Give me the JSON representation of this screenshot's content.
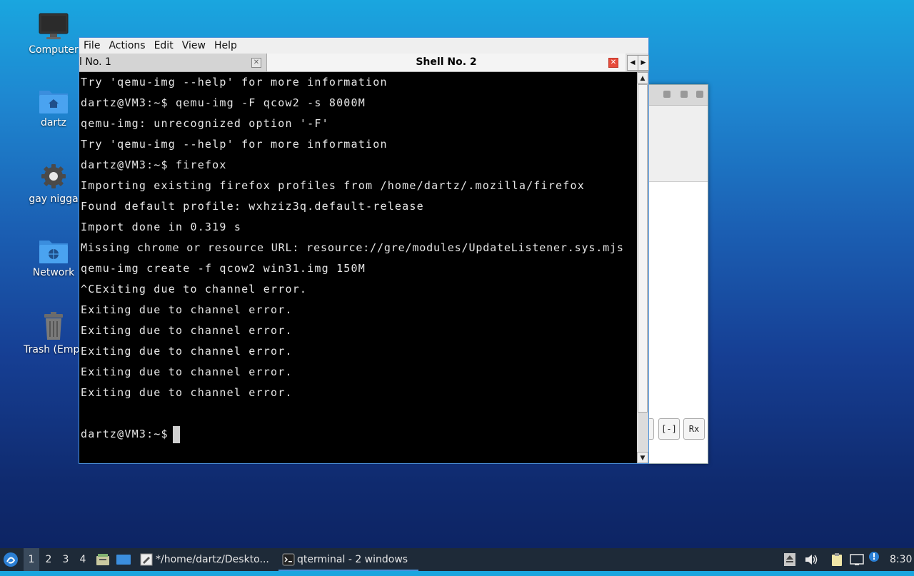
{
  "desktop": {
    "icons": [
      {
        "label": "Computer",
        "icon": "monitor-icon"
      },
      {
        "label": "dartz",
        "icon": "home-folder-icon"
      },
      {
        "label": "gay nigga",
        "icon": "gear-icon"
      },
      {
        "label": "Network",
        "icon": "network-folder-icon"
      },
      {
        "label": "Trash (Empt",
        "icon": "trash-icon"
      }
    ]
  },
  "terminal": {
    "menu": [
      "File",
      "Actions",
      "Edit",
      "View",
      "Help"
    ],
    "tabs": [
      {
        "label": "l No. 1",
        "active": false
      },
      {
        "label": "Shell No. 2",
        "active": true
      }
    ],
    "lines": [
      "Try 'qemu-img --help' for more information",
      "dartz@VM3:~$ qemu-img -F qcow2 -s 8000M",
      "qemu-img: unrecognized option '-F'",
      "Try 'qemu-img --help' for more information",
      "dartz@VM3:~$ firefox",
      "Importing existing firefox profiles from /home/dartz/.mozilla/firefox",
      "Found default profile: wxhziz3q.default-release",
      "Import done in 0.319 s",
      "Missing chrome or resource URL: resource://gre/modules/UpdateListener.sys.mjs",
      "qemu-img create -f qcow2 win31.img 150M",
      "^CExiting due to channel error.",
      "Exiting due to channel error.",
      "Exiting due to channel error.",
      "Exiting due to channel error.",
      "Exiting due to channel error.",
      "Exiting due to channel error.",
      "",
      "dartz@VM3:~$ "
    ]
  },
  "back_window": {
    "buttons": [
      "[-]",
      "Rx"
    ]
  },
  "taskbar": {
    "workspaces": [
      "1",
      "2",
      "3",
      "4"
    ],
    "tasks": [
      {
        "label": "*/home/dartz/Deskto...",
        "icon": "text-editor-icon"
      },
      {
        "label": "qterminal - 2 windows",
        "icon": "terminal-icon"
      }
    ],
    "clock": "8:30"
  },
  "colors": {
    "accent": "#4a90d9",
    "taskbar": "#1e2a38",
    "terminal_bg": "#000000",
    "terminal_fg": "#e6e6e6"
  }
}
